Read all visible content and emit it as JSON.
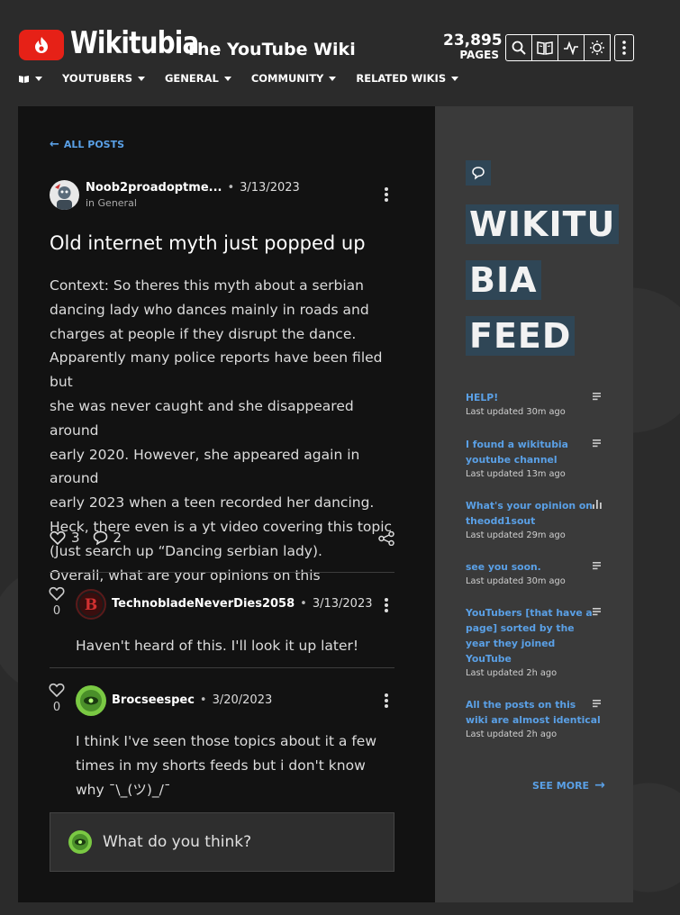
{
  "header": {
    "site_name": "Wikitubia",
    "wiki_subtitle": "The YouTube Wiki",
    "pages_count": "23,895",
    "pages_label": "PAGES",
    "brand_color": "#e62117",
    "tools": [
      "search-icon",
      "book-icon",
      "activity-icon",
      "theme-icon",
      "more-icon"
    ]
  },
  "nav": {
    "items": [
      {
        "label": "",
        "icon": "wiki-icon"
      },
      {
        "label": "YOUTUBERS"
      },
      {
        "label": "GENERAL"
      },
      {
        "label": "COMMUNITY"
      },
      {
        "label": "RELATED WIKIS"
      }
    ]
  },
  "post": {
    "back_label": "ALL POSTS",
    "author": "Noob2proadoptme...",
    "date": "3/13/2023",
    "category": "in General",
    "title": "Old internet myth just popped up",
    "body": [
      "Context: So theres this myth about a serbian",
      "dancing lady who dances mainly in roads and",
      "charges at people if they disrupt the dance.",
      "Apparently many police reports have been filed but",
      "she was never caught and she disappeared around",
      "early 2020. However, she appeared again in around",
      "early 2023 when a teen recorded her dancing.",
      "Heck, there even is a yt video covering this topic",
      "(Just search up “Dancing serbian lady).",
      "Overall, what are your opinions on this"
    ],
    "likes": "3",
    "replies_count": "2"
  },
  "replies": [
    {
      "author": "TechnobladeNeverDies2058",
      "date": "3/13/2023",
      "likes": "0",
      "text": "Haven't heard of this. I'll look it up later!"
    },
    {
      "author": "Brocseespec",
      "date": "3/20/2023",
      "likes": "0",
      "text": "I think I've seen those topics about it a few times in my shorts feeds but i don't know why ¯\\_(ツ)_/¯"
    }
  ],
  "comment_box": {
    "placeholder": "What do you think?"
  },
  "feed": {
    "title": "WIKITUBIA FEED",
    "title_lines": [
      "WIKITU",
      "BIA",
      "FEED"
    ],
    "items": [
      {
        "title": "HELP!",
        "updated": "Last updated 30m ago",
        "icon": "lines-icon"
      },
      {
        "title": "I found a wikitubia youtube channel",
        "updated": "Last updated 13m ago",
        "icon": "lines-icon"
      },
      {
        "title": "What's your opinion on theodd1sout",
        "updated": "Last updated 29m ago",
        "icon": "poll-icon"
      },
      {
        "title": "see you soon.",
        "updated": "Last updated 30m ago",
        "icon": "lines-icon"
      },
      {
        "title": "YouTubers [that have a page] sorted by the year they joined YouTube",
        "updated": "Last updated 2h ago",
        "icon": "lines-icon"
      },
      {
        "title": "All the posts on this wiki are almost identical",
        "updated": "Last updated 2h ago",
        "icon": "lines-icon"
      }
    ],
    "see_more": "SEE MORE"
  },
  "colors": {
    "link": "#5aa0e6",
    "feed_highlight": "#2f4656"
  }
}
